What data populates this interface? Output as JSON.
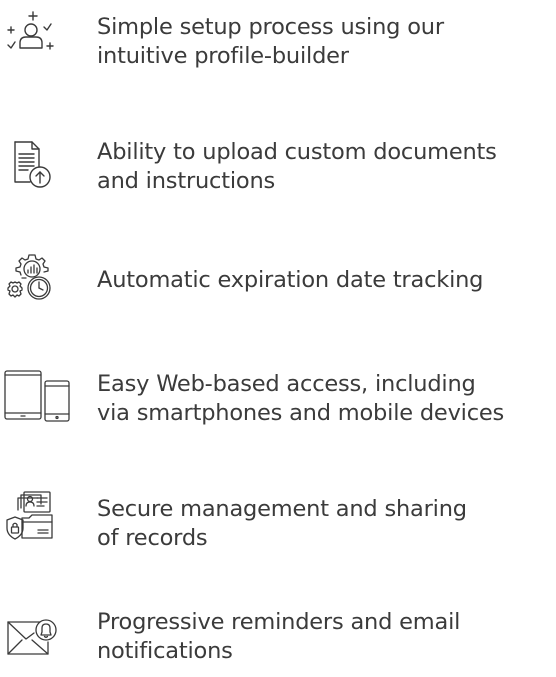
{
  "features": [
    {
      "icon": "user-add-icon",
      "lines": [
        "Simple setup process using our",
        "intuitive profile-builder"
      ]
    },
    {
      "icon": "document-upload-icon",
      "lines": [
        "Ability to upload custom documents",
        "and instructions"
      ]
    },
    {
      "icon": "settings-clock-icon",
      "lines": [
        "Automatic expiration date tracking"
      ]
    },
    {
      "icon": "tablet-phone-icon",
      "lines": [
        "Easy Web-based access, including",
        "via smartphones and mobile devices"
      ]
    },
    {
      "icon": "secure-records-icon",
      "lines": [
        "Secure management and sharing",
        "of records"
      ]
    },
    {
      "icon": "email-bell-icon",
      "lines": [
        "Progressive reminders and email",
        "notifications"
      ]
    }
  ],
  "colors": {
    "text": "#3b3b3b",
    "icon_stroke": "#3a3a3a"
  }
}
